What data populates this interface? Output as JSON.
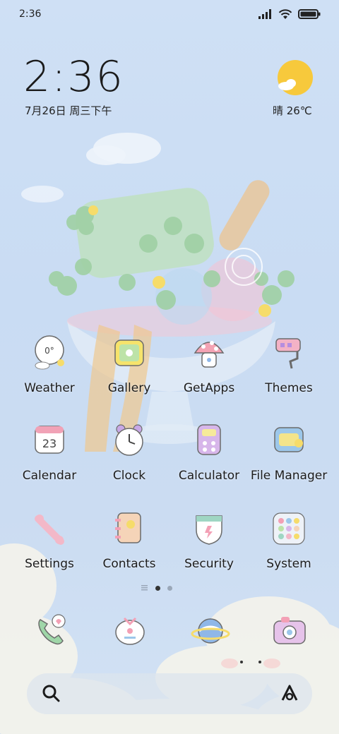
{
  "status_bar": {
    "time": "2:36"
  },
  "clock_widget": {
    "time": "2:36",
    "date": "7月26日 周三下午"
  },
  "weather_widget": {
    "text": "晴 26℃"
  },
  "apps_row1": [
    {
      "label": "Weather"
    },
    {
      "label": "Gallery"
    },
    {
      "label": "GetApps"
    },
    {
      "label": "Themes"
    }
  ],
  "apps_row2": [
    {
      "label": "Calendar",
      "icon_text": "23"
    },
    {
      "label": "Clock"
    },
    {
      "label": "Calculator"
    },
    {
      "label": "File Manager"
    }
  ],
  "apps_row3": [
    {
      "label": "Settings"
    },
    {
      "label": "Contacts"
    },
    {
      "label": "Security"
    },
    {
      "label": "System"
    }
  ],
  "weather_icon_text": "0°",
  "pages": {
    "current": 1,
    "count": 2
  },
  "dock": [
    {
      "icon": "phone-icon"
    },
    {
      "icon": "messages-icon"
    },
    {
      "icon": "browser-icon"
    },
    {
      "icon": "camera-icon"
    }
  ],
  "search": {
    "icon": "search-icon"
  }
}
